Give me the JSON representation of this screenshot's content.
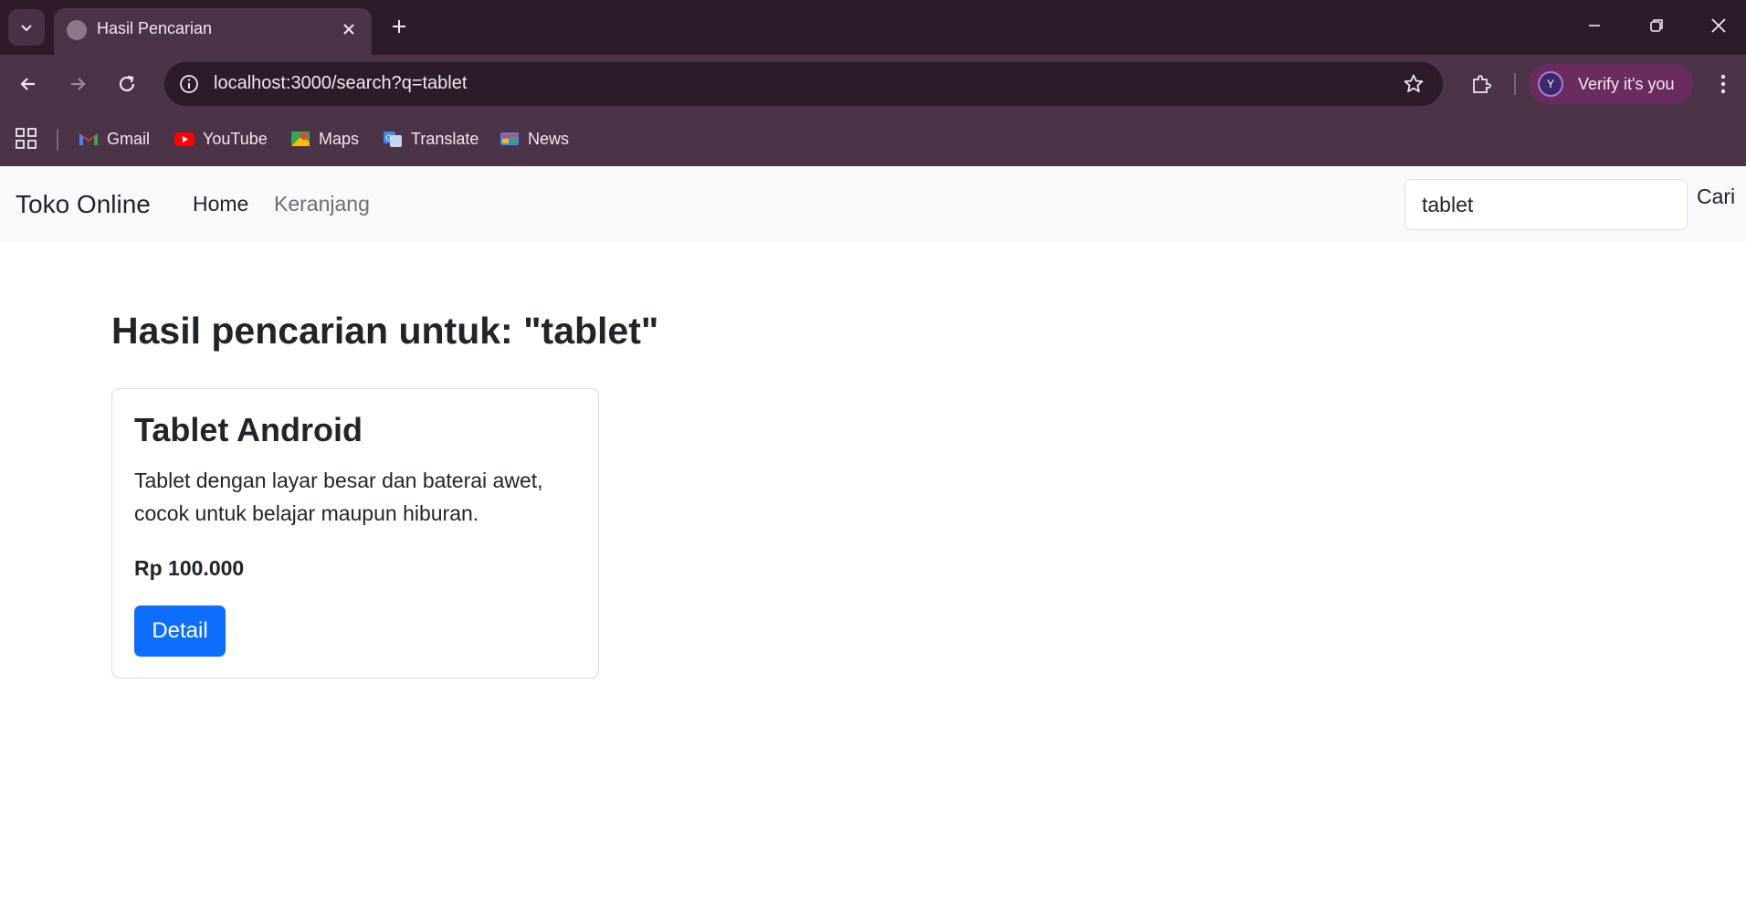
{
  "browser": {
    "tab": {
      "title": "Hasil Pencarian"
    },
    "address_bar": {
      "url": "localhost:3000/search?q=tablet"
    },
    "profile": {
      "label": "Verify it's you",
      "avatar_letter": "Y"
    },
    "bookmarks": [
      {
        "label": "Gmail",
        "icon": "gmail-icon"
      },
      {
        "label": "YouTube",
        "icon": "youtube-icon"
      },
      {
        "label": "Maps",
        "icon": "maps-icon"
      },
      {
        "label": "Translate",
        "icon": "translate-icon"
      },
      {
        "label": "News",
        "icon": "news-icon"
      }
    ],
    "colors": {
      "tabbar": "#2d1b29",
      "toolbar": "#4b3448",
      "profile_chip": "#6a2c5e"
    }
  },
  "navbar": {
    "brand": "Toko Online",
    "links": [
      "Home",
      "Keranjang"
    ],
    "search": {
      "value": "tablet",
      "button_label": "Cari"
    }
  },
  "main": {
    "heading": "Hasil pencarian untuk: \"tablet\"",
    "results": [
      {
        "title": "Tablet Android",
        "description": "Tablet dengan layar besar dan baterai awet, cocok untuk belajar maupun hiburan.",
        "price": "Rp 100.000",
        "button_label": "Detail"
      }
    ],
    "colors": {
      "primary_button": "#0d6efd",
      "navbar_bg": "#f8f9fa"
    }
  }
}
